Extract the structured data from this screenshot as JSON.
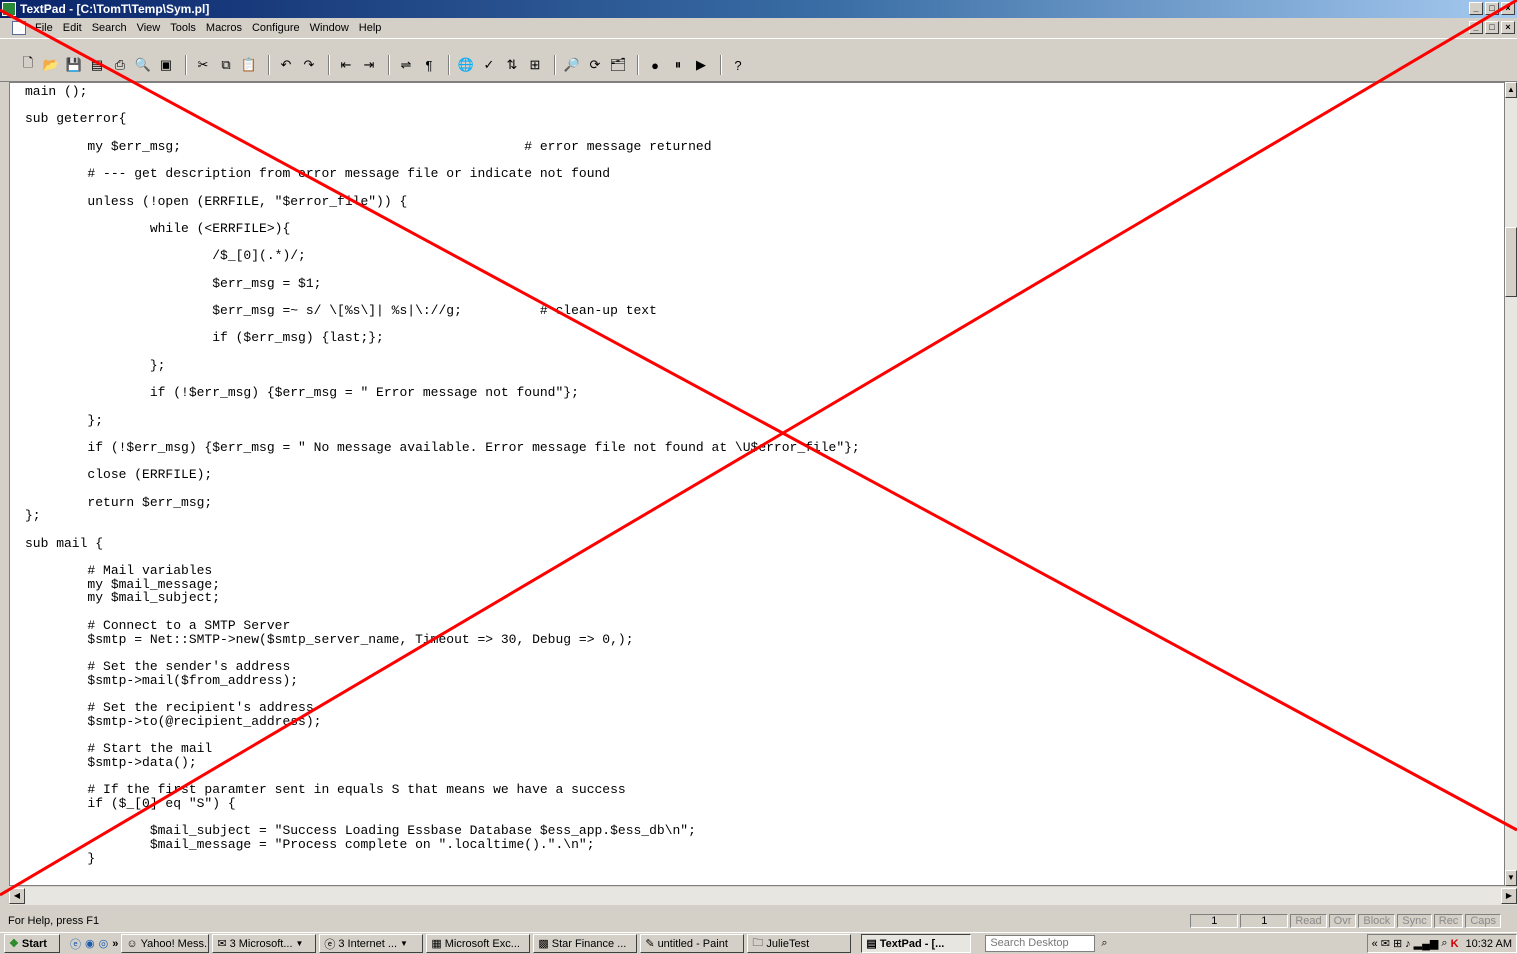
{
  "window": {
    "title": "TextPad - [C:\\TomT\\Temp\\Sym.pl]"
  },
  "menu": [
    "File",
    "Edit",
    "Search",
    "View",
    "Tools",
    "Macros",
    "Configure",
    "Window",
    "Help"
  ],
  "code_lines": [
    "main ();",
    "",
    "sub geterror{",
    "",
    "        my $err_msg;                                            # error message returned",
    "",
    "        # --- get description from error message file or indicate not found",
    "",
    "        unless (!open (ERRFILE, \"$error_file\")) {",
    "",
    "                while (<ERRFILE>){",
    "",
    "                        /$_[0](.*)/;",
    "",
    "                        $err_msg = $1;",
    "",
    "                        $err_msg =~ s/ \\[%s\\]| %s|\\://g;          # clean-up text",
    "",
    "                        if ($err_msg) {last;};",
    "",
    "                };",
    "",
    "                if (!$err_msg) {$err_msg = \" Error message not found\"};",
    "",
    "        };",
    "",
    "        if (!$err_msg) {$err_msg = \" No message available. Error message file not found at \\U$error_file\"};",
    "",
    "        close (ERRFILE);",
    "",
    "        return $err_msg;",
    "};",
    "",
    "sub mail {",
    "",
    "        # Mail variables",
    "        my $mail_message;",
    "        my $mail_subject;",
    "",
    "        # Connect to a SMTP Server",
    "        $smtp = Net::SMTP->new($smtp_server_name, Timeout => 30, Debug => 0,);",
    "",
    "        # Set the sender's address",
    "        $smtp->mail($from_address);",
    "",
    "        # Set the recipient's address",
    "        $smtp->to(@recipient_address);",
    "",
    "        # Start the mail",
    "        $smtp->data();",
    "",
    "        # If the first paramter sent in equals S that means we have a success",
    "        if ($_[0] eq \"S\") {",
    "",
    "                $mail_subject = \"Success Loading Essbase Database $ess_app.$ess_db\\n\";",
    "                $mail_message = \"Process complete on \".localtime().\".\\n\";",
    "        }"
  ],
  "status": {
    "help": "For Help, press F1",
    "line": "1",
    "col": "1",
    "modes": [
      "Read",
      "Ovr",
      "Block",
      "Sync",
      "Rec",
      "Caps"
    ]
  },
  "taskbar": {
    "start": "Start",
    "tasks": [
      {
        "label": "Yahoo! Mess...",
        "icon": "yahoo-messenger-icon"
      },
      {
        "label": "3 Microsoft...",
        "icon": "outlook-icon"
      },
      {
        "label": "3 Internet ...",
        "icon": "internet-explorer-icon"
      },
      {
        "label": "Microsoft Exc...",
        "icon": "excel-icon"
      },
      {
        "label": "Star Finance ...",
        "icon": "star-finance-icon"
      },
      {
        "label": "untitled - Paint",
        "icon": "paint-icon"
      },
      {
        "label": "JulieTest",
        "icon": "folder-icon"
      },
      {
        "label": "TextPad - [...",
        "icon": "textpad-icon",
        "active": true
      }
    ],
    "search_placeholder": "Search Desktop",
    "clock": "10:32 AM"
  },
  "colors": {
    "title_start": "#0a246a",
    "overlay_cross": "#ff0000"
  }
}
